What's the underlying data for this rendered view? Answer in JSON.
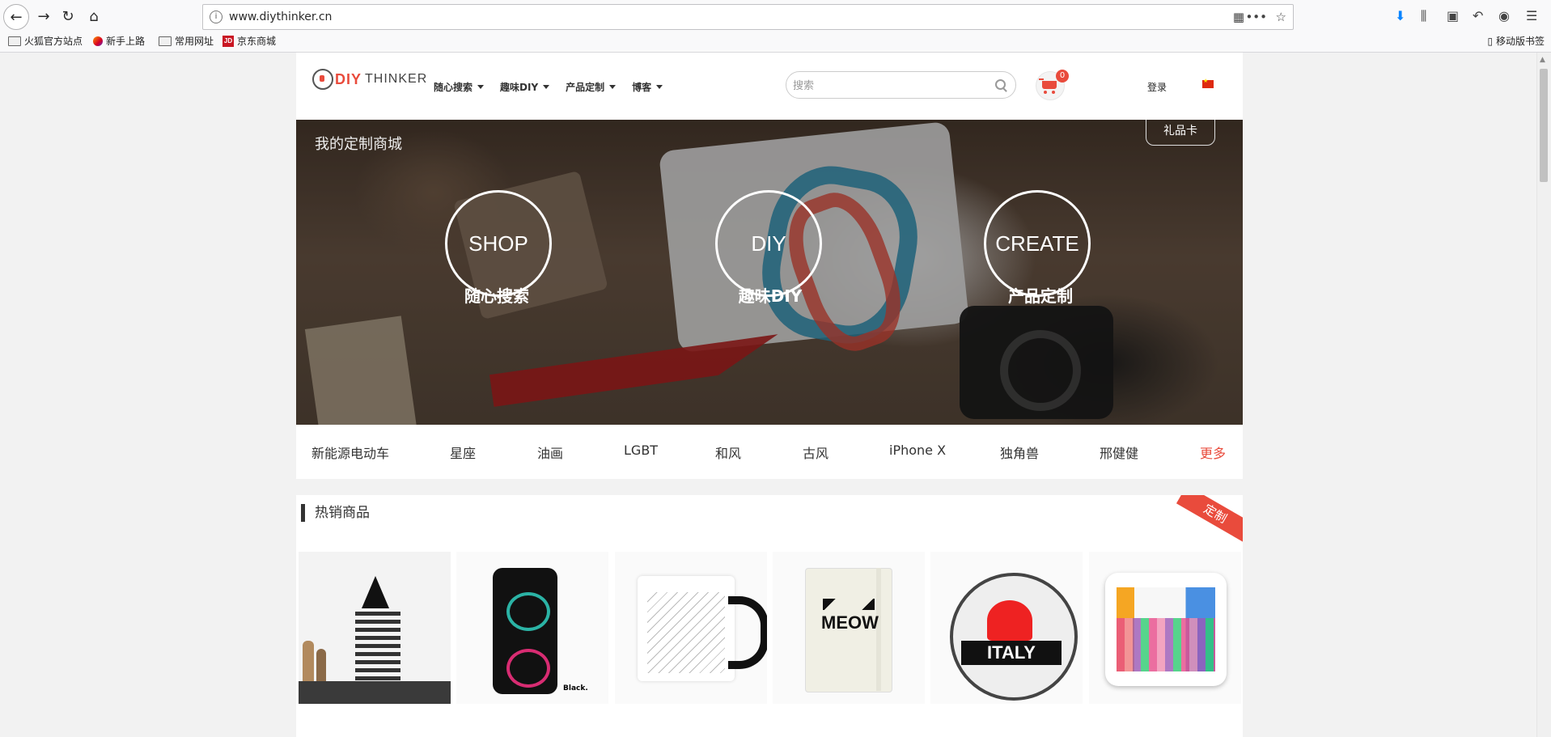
{
  "browser": {
    "url": "www.diythinker.cn",
    "bookmarks": [
      "火狐官方站点",
      "新手上路",
      "常用网址",
      "京东商城"
    ],
    "mobile_bookmarks": "移动版书签"
  },
  "header": {
    "logo_diy": "DIY",
    "logo_thinker": "THINKER",
    "nav": [
      "随心搜索",
      "趣味DIY",
      "产品定制",
      "博客"
    ],
    "search_placeholder": "搜索",
    "cart_count": "0",
    "login": "登录"
  },
  "hero": {
    "title": "我的定制商城",
    "gift_card": "礼品卡",
    "buttons": [
      {
        "en": "SHOP",
        "zh": "随心搜索"
      },
      {
        "en": "DIY",
        "zh": "趣味DIY"
      },
      {
        "en": "CREATE",
        "zh": "产品定制"
      }
    ]
  },
  "tags": [
    "新能源电动车",
    "星座",
    "油画",
    "LGBT",
    "和风",
    "古风",
    "iPhone X",
    "独角兽",
    "邢健健",
    "更多"
  ],
  "hot": {
    "title": "热销商品",
    "ribbon": "定制",
    "products": [
      {
        "icon": "pineapple-wall-art"
      },
      {
        "icon": "sugar-skull-phone-case",
        "caption": "Black."
      },
      {
        "icon": "chemistry-mug"
      },
      {
        "icon": "meow-notebook",
        "text": "MEOW"
      },
      {
        "icon": "i-love-italy-button-pin",
        "text": "ITALY"
      },
      {
        "icon": "periodic-table-pillow"
      }
    ]
  },
  "colors": {
    "accent": "#e94b3c",
    "background": "#f2f2f2"
  }
}
